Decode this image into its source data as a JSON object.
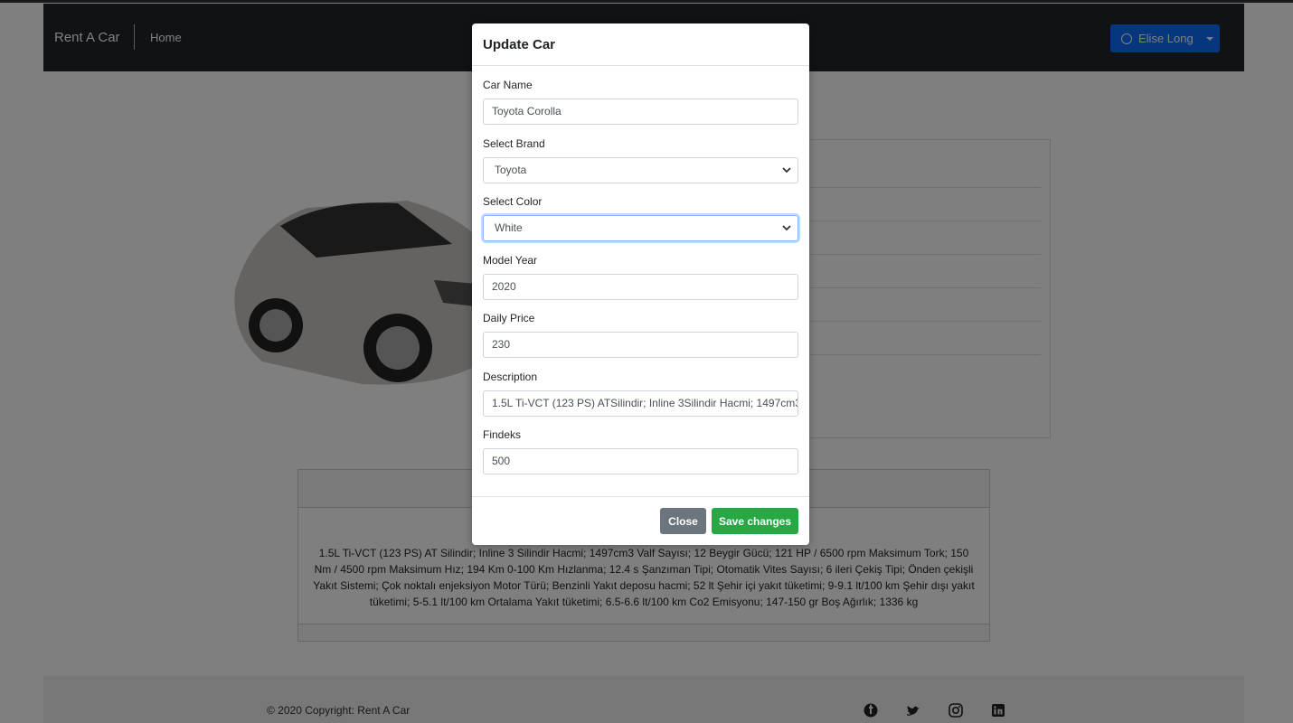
{
  "navbar": {
    "brand": "Rent A Car",
    "home_link": "Home",
    "user_name": "Elise Long"
  },
  "description_card": {
    "text": "1.5L Ti-VCT (123 PS) AT Silindir; Inline 3 Silindir Hacmi; 1497cm3 Valf Sayısı; 12 Beygir Gücü; 121 HP / 6500 rpm Maksimum Tork; 150 Nm / 4500 rpm Maksimum Hız; 194 Km 0-100 Km Hızlanma; 12.4 s Şanzıman Tipi; Otomatik Vites Sayısı; 6 ileri Çekiş Tipi; Önden çekişli Yakıt Sistemi; Çok noktalı enjeksiyon Motor Türü; Benzinli Yakıt deposu hacmi; 52 lt Şehir içi yakıt tüketimi; 9-9.1 lt/100 km Şehir dışı yakıt tüketimi; 5-5.1 lt/100 km Ortalama Yakıt tüketimi; 6.5-6.6 lt/100 km Co2 Emisyonu; 147-150 gr Boş Ağırlık; 1336 kg"
  },
  "footer": {
    "copyright": "© 2020 Copyright: Rent A Car",
    "social_icons": [
      "facebook-icon",
      "twitter-icon",
      "instagram-icon",
      "linkedin-icon"
    ]
  },
  "modal": {
    "title": "Update Car",
    "fields": {
      "car_name": {
        "label": "Car Name",
        "value": "Toyota Corolla"
      },
      "brand": {
        "label": "Select Brand",
        "value": "Toyota"
      },
      "color": {
        "label": "Select Color",
        "value": "White"
      },
      "model_year": {
        "label": "Model Year",
        "value": "2020"
      },
      "daily_price": {
        "label": "Daily Price",
        "value": "230"
      },
      "description": {
        "label": "Description",
        "value": "1.5L Ti-VCT (123 PS) ATSilindir; Inline 3Silindir Hacmi; 1497cm3"
      },
      "findeks": {
        "label": "Findeks",
        "value": "500"
      }
    },
    "close_label": "Close",
    "save_label": "Save changes"
  },
  "colors": {
    "navbar": "#212529",
    "primary": "#0d6efd",
    "success": "#28a745",
    "secondary": "#6c757d"
  }
}
